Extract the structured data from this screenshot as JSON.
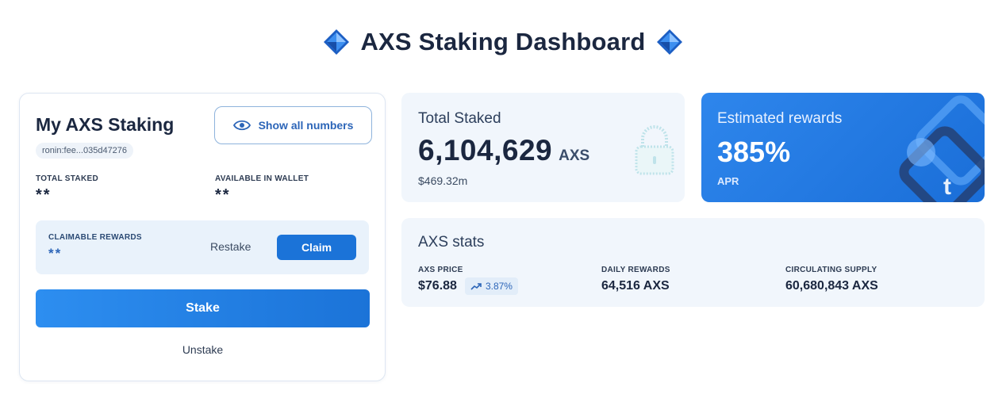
{
  "header": {
    "title": "AXS Staking Dashboard",
    "icon_left": "axs-gem-icon",
    "icon_right": "axs-gem-icon"
  },
  "my_staking": {
    "title": "My AXS Staking",
    "address": "ronin:fee...035d47276",
    "show_numbers_label": "Show all numbers",
    "total_staked_label": "TOTAL STAKED",
    "total_staked_value": "**",
    "available_label": "AVAILABLE IN WALLET",
    "available_value": "**",
    "claimable_label": "CLAIMABLE REWARDS",
    "claimable_value": "**",
    "restake_label": "Restake",
    "claim_label": "Claim",
    "stake_label": "Stake",
    "unstake_label": "Unstake"
  },
  "total_staked": {
    "title": "Total Staked",
    "value": "6,104,629",
    "unit": "AXS",
    "usd": "$469.32m",
    "icon": "lock-icon"
  },
  "rewards": {
    "title": "Estimated rewards",
    "value": "385%",
    "label": "APR"
  },
  "stats": {
    "title": "AXS stats",
    "price_label": "AXS PRICE",
    "price_value": "$76.88",
    "price_change": "3.87%",
    "daily_label": "DAILY REWARDS",
    "daily_value": "64,516 AXS",
    "supply_label": "CIRCULATING SUPPLY",
    "supply_value": "60,680,843 AXS"
  },
  "colors": {
    "accent": "#1b73d8",
    "card_bg": "#f1f6fc",
    "title": "#1b2740"
  }
}
